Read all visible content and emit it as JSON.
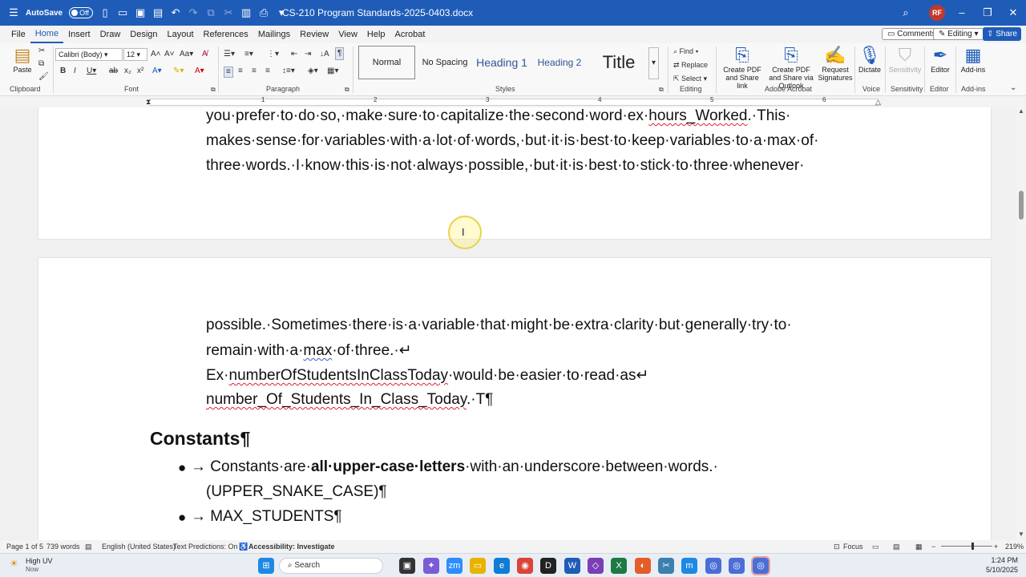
{
  "titlebar": {
    "autosave_label": "AutoSave",
    "autosave_state": "Off",
    "document_title": "CS-210 Program Standards-2025-0403.docx",
    "avatar_initials": "RF"
  },
  "menu": {
    "items": [
      "File",
      "Home",
      "Insert",
      "Draw",
      "Design",
      "Layout",
      "References",
      "Mailings",
      "Review",
      "View",
      "Help",
      "Acrobat"
    ],
    "active": "Home",
    "comments_label": "Comments",
    "editing_label": "Editing",
    "share_label": "Share"
  },
  "ribbon": {
    "paste_label": "Paste",
    "font_name": "Calibri (Body)",
    "font_size": "12",
    "styles": [
      "Normal",
      "No Spacing",
      "Heading 1",
      "Heading 2",
      "Title"
    ],
    "find_label": "Find",
    "replace_label": "Replace",
    "select_label": "Select",
    "create_pdf_label": "Create PDF and Share link",
    "create_pdf_outlook_label": "Create PDF and Share via Outlook",
    "request_signatures_label": "Request Signatures",
    "dictate_label": "Dictate",
    "sensitivity_label": "Sensitivity",
    "editor_label": "Editor",
    "addins_label": "Add-ins",
    "groups": {
      "clipboard": "Clipboard",
      "font": "Font",
      "paragraph": "Paragraph",
      "styles": "Styles",
      "editing": "Editing",
      "adobe": "Adobe Acrobat",
      "voice": "Voice",
      "sensitivity": "Sensitivity",
      "editor": "Editor",
      "addins": "Add-ins"
    }
  },
  "ruler": {
    "numbers": [
      "1",
      "2",
      "3",
      "4",
      "5",
      "6"
    ]
  },
  "document": {
    "page1_lines": [
      [
        "you·prefer·to·do·so,·make·sure·to·capitalize·the·second·word·ex·",
        "hours_Worked",
        ".·This·"
      ],
      [
        "makes·sense·for·variables·with·a·lot·of·words,·but·it·is·best·to·keep·variables·to·a·max·of·"
      ],
      [
        "three·words.·I·know·this·is·not·always·possible,·but·it·is·best·to·stick·to·three·whenever·"
      ]
    ],
    "page2": {
      "line1": "possible.·Sometimes·there·is·a·variable·that·might·be·extra·clarity·but·generally·try·to·",
      "line2_pre": "remain·with·a·",
      "line2_word": "max",
      "line2_post": "·of·three.·↵",
      "line3_pre": "Ex·",
      "line3_word": "numberOfStudentsInClassToday",
      "line3_post": "·would·be·easier·to·read·as↵",
      "line4_word": "number_Of_Students_In_Class_Today",
      "line4_post": ".·T¶",
      "heading": "Constants¶",
      "bullet1_pre": "→ Constants·are·",
      "bullet1_bold": "all·upper-case·letters",
      "bullet1_post": "·with·an·underscore·between·words.·",
      "bullet1_cont": "(UPPER_SNAKE_CASE)¶",
      "bullet2": "→ MAX_STUDENTS¶"
    }
  },
  "statusbar": {
    "page": "Page 1 of 5",
    "words": "739 words",
    "language": "English (United States)",
    "predictions": "Text Predictions: On",
    "accessibility": "Accessibility: Investigate",
    "focus": "Focus",
    "zoom": "219%"
  },
  "taskbar": {
    "weather_title": "High UV",
    "weather_sub": "Now",
    "search_label": "Search",
    "time": "1:24 PM",
    "date": "5/10/2025"
  },
  "colors": {
    "accent": "#1f5cb8",
    "spell_error": "#dd2233",
    "grammar": "#3a5bd0"
  }
}
